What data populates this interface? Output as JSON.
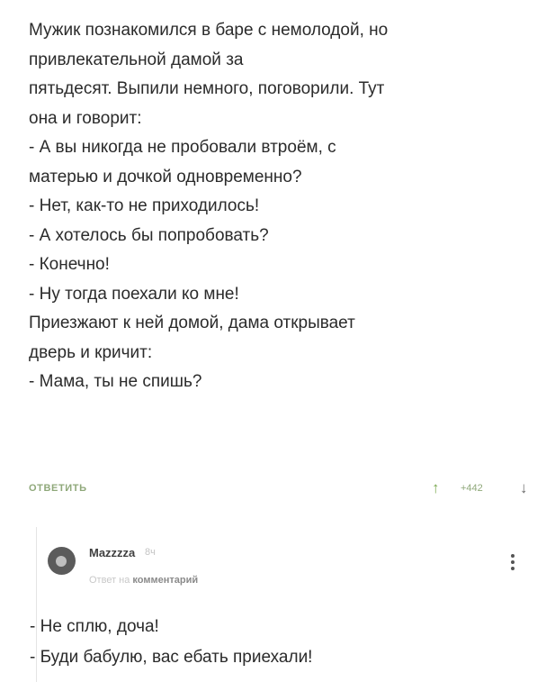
{
  "post": {
    "lines": [
      "Мужик познакомился в баре с немолодой, но",
      "привлекательной дамой за",
      "пятьдесят. Выпили немного, поговорили. Тут",
      "она и говорит:",
      "- А вы никогда не пробовали втроём, с",
      "матерью и дочкой одновременно?",
      "- Нет, как-то не приходилось!",
      "- А хотелось бы попробовать?",
      "- Конечно!",
      "- Ну тогда поехали ко мне!",
      "Приезжают к ней домой, дама открывает",
      "дверь и кричит:",
      "- Мама, ты не спишь?"
    ]
  },
  "actions": {
    "reply_label": "ОТВЕТИТЬ",
    "up_icon": "↑",
    "score": "+442",
    "down_icon": "↓"
  },
  "comment": {
    "username": "Mazzzza",
    "time": "8ч",
    "reply_prefix": "Ответ на ",
    "reply_target": "комментарий",
    "lines": [
      "- Не сплю, доча!",
      "- Буди бабулю, вас ебать приехали!"
    ]
  }
}
